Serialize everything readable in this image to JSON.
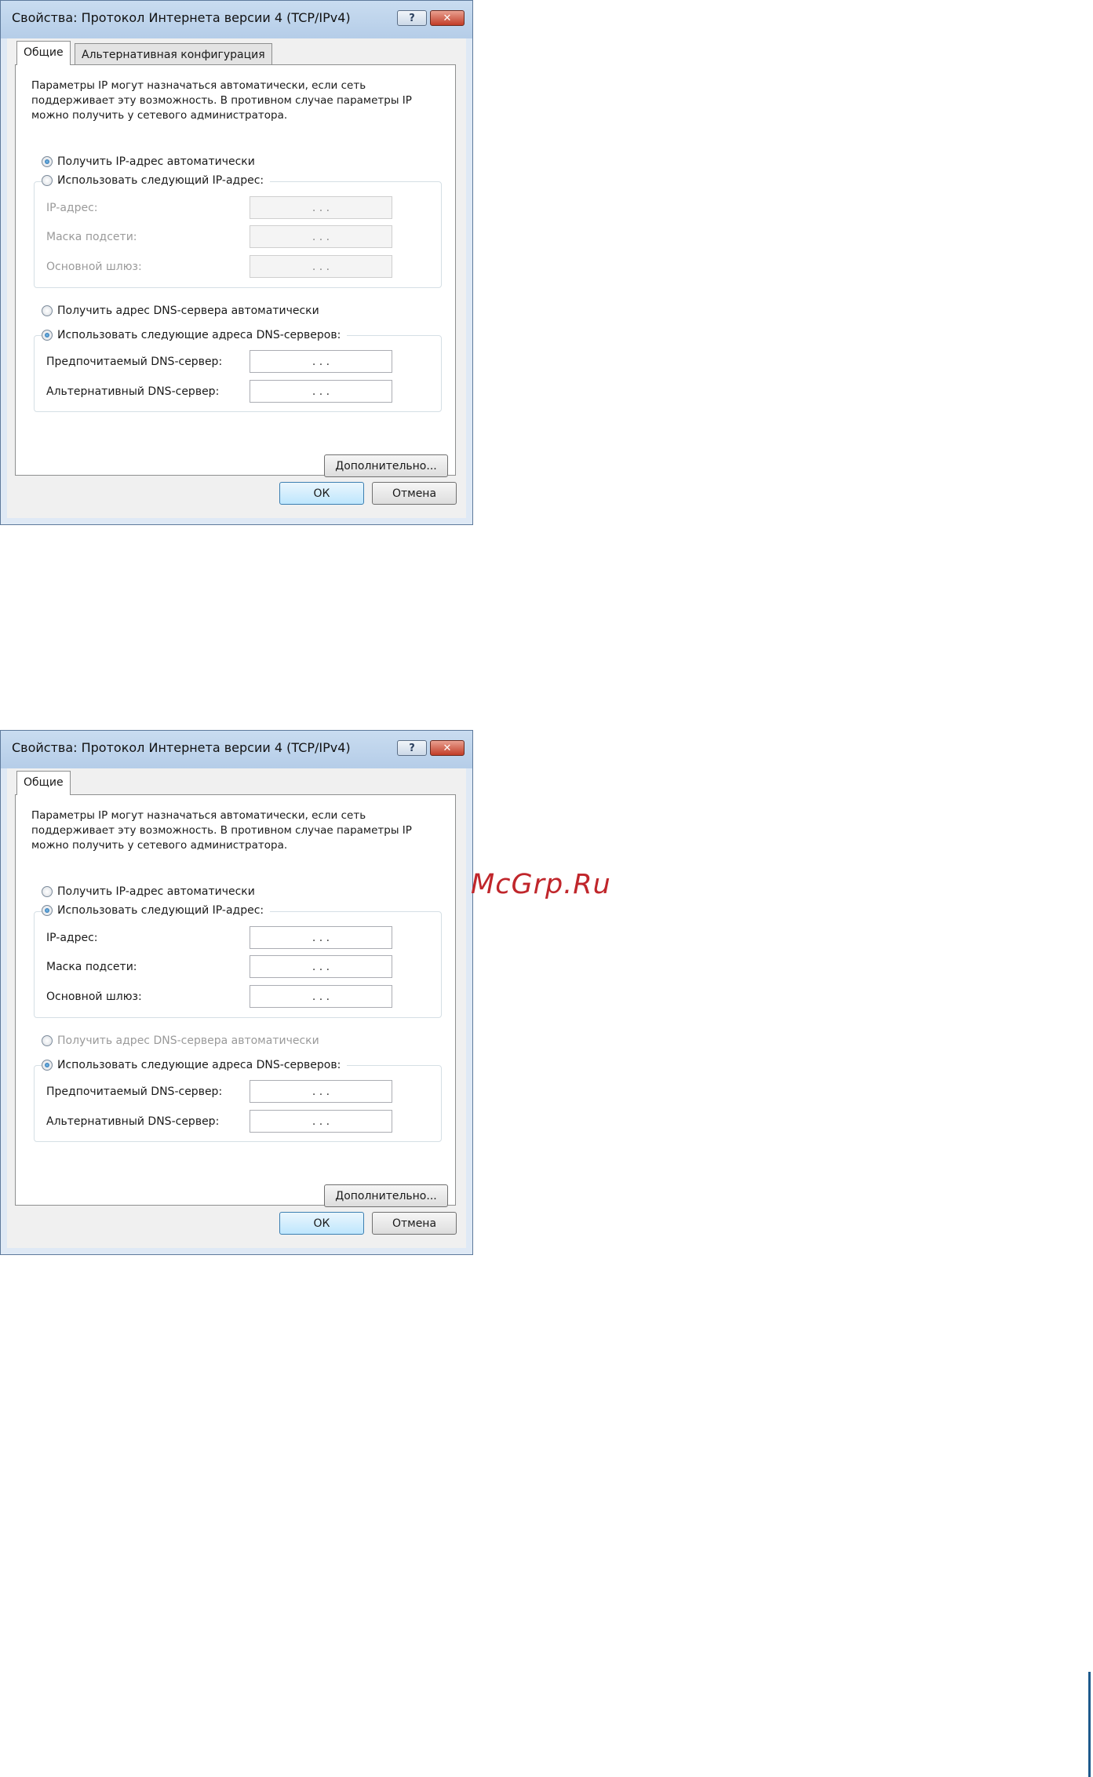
{
  "dialogs": [
    {
      "title": "Свойства: Протокол Интернета версии 4 (TCP/IPv4)",
      "help_glyph": "?",
      "close_glyph": "✕",
      "tabs": [
        "Общие",
        "Альтернативная конфигурация"
      ],
      "description": "Параметры IP могут назначаться автоматически, если сеть поддерживает эту возможность. В противном случае параметры IP можно получить у сетевого администратора.",
      "ip_auto_label": "Получить IP-адрес автоматически",
      "ip_auto_selected": true,
      "ip_manual_label": "Использовать следующий IP-адрес:",
      "ip_manual_selected": false,
      "ip_fields": [
        {
          "label": "IP-адрес:",
          "value": ". . .",
          "enabled": false
        },
        {
          "label": "Маска подсети:",
          "value": ". . .",
          "enabled": false
        },
        {
          "label": "Основной шлюз:",
          "value": ". . .",
          "enabled": false
        }
      ],
      "dns_auto_label": "Получить адрес DNS-сервера автоматически",
      "dns_auto_selected": false,
      "dns_auto_enabled": true,
      "dns_manual_label": "Использовать следующие адреса DNS-серверов:",
      "dns_manual_selected": true,
      "dns_fields": [
        {
          "label": "Предпочитаемый DNS-сервер:",
          "value": ". . .",
          "enabled": true
        },
        {
          "label": "Альтернативный DNS-сервер:",
          "value": ". . .",
          "enabled": true
        }
      ],
      "advanced_label": "Дополнительно...",
      "ok_label": "ОК",
      "cancel_label": "Отмена"
    },
    {
      "title": "Свойства: Протокол Интернета версии 4 (TCP/IPv4)",
      "help_glyph": "?",
      "close_glyph": "✕",
      "tabs": [
        "Общие"
      ],
      "description": "Параметры IP могут назначаться автоматически, если сеть поддерживает эту возможность. В противном случае параметры IP можно получить у сетевого администратора.",
      "ip_auto_label": "Получить IP-адрес автоматически",
      "ip_auto_selected": false,
      "ip_manual_label": "Использовать следующий IP-адрес:",
      "ip_manual_selected": true,
      "ip_fields": [
        {
          "label": "IP-адрес:",
          "value": ". . .",
          "enabled": true
        },
        {
          "label": "Маска подсети:",
          "value": ". . .",
          "enabled": true
        },
        {
          "label": "Основной шлюз:",
          "value": ". . .",
          "enabled": true
        }
      ],
      "dns_auto_label": "Получить адрес DNS-сервера автоматически",
      "dns_auto_selected": false,
      "dns_auto_enabled": false,
      "dns_manual_label": "Использовать следующие адреса DNS-серверов:",
      "dns_manual_selected": true,
      "dns_fields": [
        {
          "label": "Предпочитаемый DNS-сервер:",
          "value": ". . .",
          "enabled": true
        },
        {
          "label": "Альтернативный DNS-сервер:",
          "value": ". . .",
          "enabled": true
        }
      ],
      "advanced_label": "Дополнительно...",
      "ok_label": "ОК",
      "cancel_label": "Отмена"
    }
  ],
  "watermark": "McGrp.Ru",
  "colors": {
    "accent": "#3c7fb1",
    "watermark": "#c0262b",
    "side_line": "#1e5a8c"
  }
}
